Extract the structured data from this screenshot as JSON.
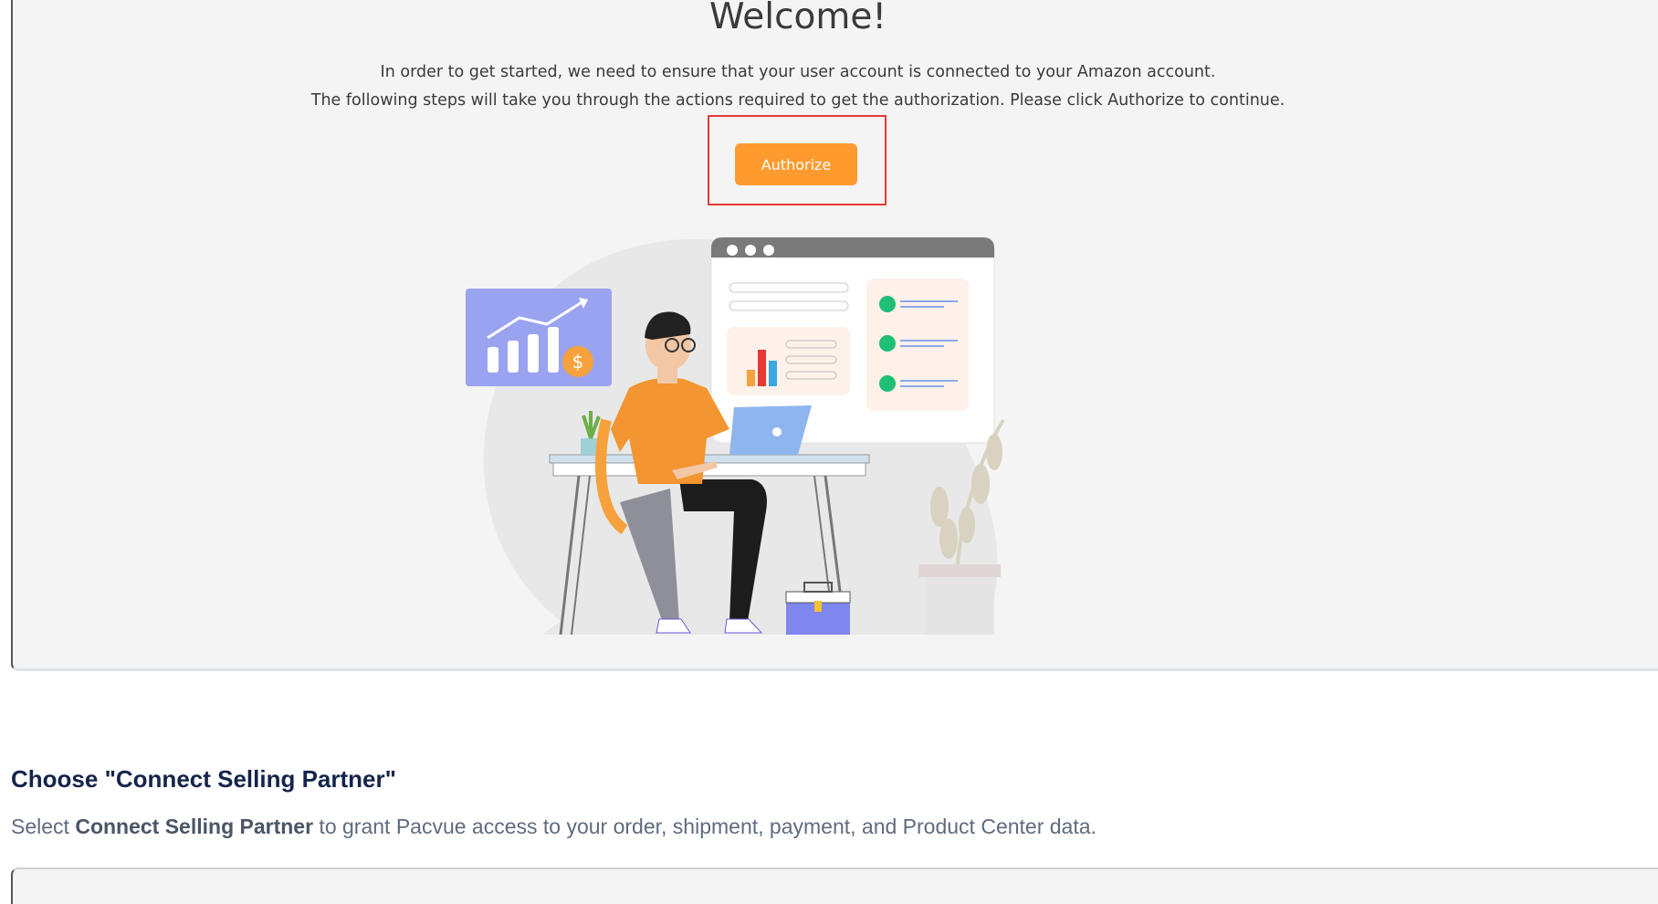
{
  "welcome": {
    "title": "Welcome!",
    "line1": "In order to get started, we need to ensure that your user account is connected to your Amazon account.",
    "line2": "The following steps will take you through the actions required to get the authorization. Please click Authorize to continue.",
    "authorize_label": "Authorize",
    "illustration_dollar": "$"
  },
  "step": {
    "heading": "Choose \"Connect Selling Partner\"",
    "desc_prefix": "Select ",
    "desc_bold": "Connect Selling Partner",
    "desc_suffix": " to grant Pacvue access to your order, shipment, payment, and Product Center data."
  },
  "colors": {
    "accent_orange": "#ff9a2e",
    "highlight_red": "#e53935",
    "heading_navy": "#14244a"
  }
}
